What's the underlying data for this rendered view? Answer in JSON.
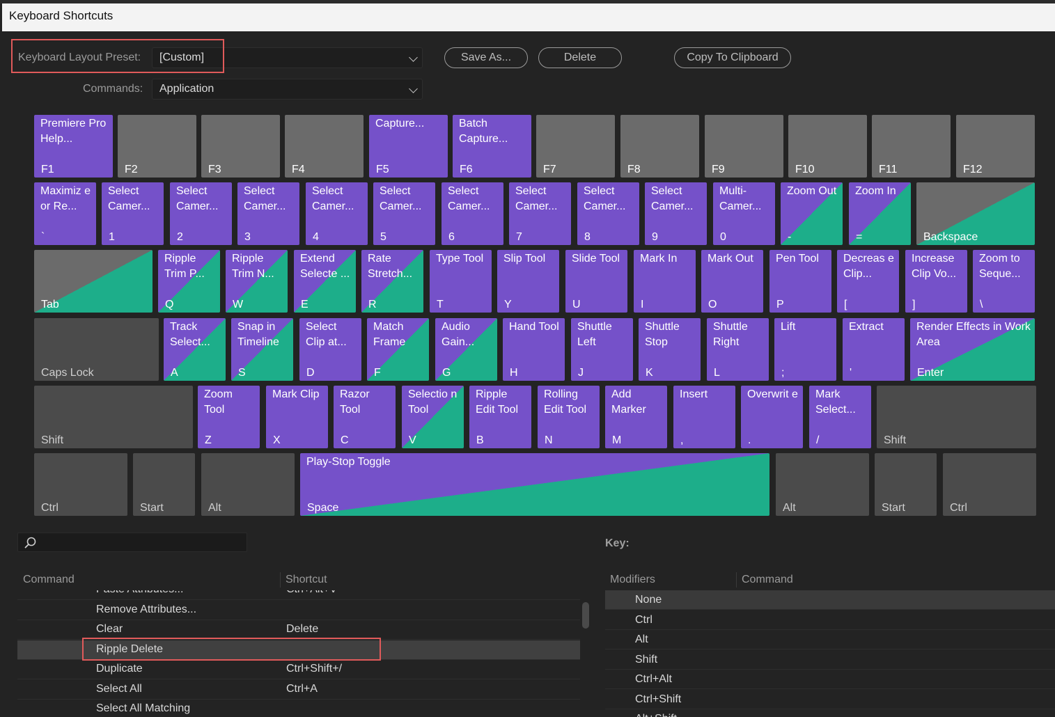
{
  "window": {
    "title": "Keyboard Shortcuts"
  },
  "preset": {
    "label": "Keyboard Layout Preset:",
    "value": "[Custom]"
  },
  "commands": {
    "label": "Commands:",
    "value": "Application"
  },
  "buttons": {
    "save_as": "Save As...",
    "delete": "Delete",
    "copy": "Copy To Clipboard"
  },
  "keyboard": {
    "rows": [
      [
        {
          "k": "F1",
          "c": "Premiere Pro Help...",
          "t": "app"
        },
        {
          "k": "F2",
          "c": "",
          "t": "none"
        },
        {
          "k": "F3",
          "c": "",
          "t": "none"
        },
        {
          "k": "F4",
          "c": "",
          "t": "none"
        },
        {
          "k": "F5",
          "c": "Capture...",
          "t": "app"
        },
        {
          "k": "F6",
          "c": "Batch Capture...",
          "t": "app"
        },
        {
          "k": "F7",
          "c": "",
          "t": "none"
        },
        {
          "k": "F8",
          "c": "",
          "t": "none"
        },
        {
          "k": "F9",
          "c": "",
          "t": "none"
        },
        {
          "k": "F10",
          "c": "",
          "t": "none"
        },
        {
          "k": "F11",
          "c": "",
          "t": "none"
        },
        {
          "k": "F12",
          "c": "",
          "t": "none"
        }
      ],
      [
        {
          "k": "`",
          "c": "Maximiz e or Re...",
          "t": "app"
        },
        {
          "k": "1",
          "c": "Select Camer...",
          "t": "app"
        },
        {
          "k": "2",
          "c": "Select Camer...",
          "t": "app"
        },
        {
          "k": "3",
          "c": "Select Camer...",
          "t": "app"
        },
        {
          "k": "4",
          "c": "Select Camer...",
          "t": "app"
        },
        {
          "k": "5",
          "c": "Select Camer...",
          "t": "app"
        },
        {
          "k": "6",
          "c": "Select Camer...",
          "t": "app"
        },
        {
          "k": "7",
          "c": "Select Camer...",
          "t": "app"
        },
        {
          "k": "8",
          "c": "Select Camer...",
          "t": "app"
        },
        {
          "k": "9",
          "c": "Select Camer...",
          "t": "app"
        },
        {
          "k": "0",
          "c": "Multi- Camer...",
          "t": "app"
        },
        {
          "k": "-",
          "c": "Zoom Out",
          "t": "mix"
        },
        {
          "k": "=",
          "c": "Zoom In",
          "t": "mix"
        },
        {
          "k": "Backspace",
          "c": "",
          "t": "panel"
        }
      ],
      [
        {
          "k": "Tab",
          "c": "",
          "t": "panel"
        },
        {
          "k": "Q",
          "c": "Ripple Trim P...",
          "t": "mix"
        },
        {
          "k": "W",
          "c": "Ripple Trim N...",
          "t": "mix"
        },
        {
          "k": "E",
          "c": "Extend Selecte ...",
          "t": "mix"
        },
        {
          "k": "R",
          "c": "Rate Stretch...",
          "t": "mix"
        },
        {
          "k": "T",
          "c": "Type Tool",
          "t": "app"
        },
        {
          "k": "Y",
          "c": "Slip Tool",
          "t": "app"
        },
        {
          "k": "U",
          "c": "Slide Tool",
          "t": "app"
        },
        {
          "k": "I",
          "c": "Mark In",
          "t": "app"
        },
        {
          "k": "O",
          "c": "Mark Out",
          "t": "app"
        },
        {
          "k": "P",
          "c": "Pen Tool",
          "t": "app"
        },
        {
          "k": "[",
          "c": "Decreas e Clip...",
          "t": "app"
        },
        {
          "k": "]",
          "c": "Increase Clip Vo...",
          "t": "app"
        },
        {
          "k": "\\",
          "c": "Zoom to Seque...",
          "t": "app"
        }
      ],
      [
        {
          "k": "Caps Lock",
          "c": "",
          "t": "mod"
        },
        {
          "k": "A",
          "c": "Track Select...",
          "t": "mix"
        },
        {
          "k": "S",
          "c": "Snap in Timeline",
          "t": "mix"
        },
        {
          "k": "D",
          "c": "Select Clip at...",
          "t": "app"
        },
        {
          "k": "F",
          "c": "Match Frame",
          "t": "mix"
        },
        {
          "k": "G",
          "c": "Audio Gain...",
          "t": "mix"
        },
        {
          "k": "H",
          "c": "Hand Tool",
          "t": "app"
        },
        {
          "k": "J",
          "c": "Shuttle Left",
          "t": "app"
        },
        {
          "k": "K",
          "c": "Shuttle Stop",
          "t": "app"
        },
        {
          "k": "L",
          "c": "Shuttle Right",
          "t": "app"
        },
        {
          "k": ";",
          "c": "Lift",
          "t": "app"
        },
        {
          "k": "'",
          "c": "Extract",
          "t": "app"
        },
        {
          "k": "Enter",
          "c": "Render Effects in Work Area",
          "t": "mix"
        }
      ],
      [
        {
          "k": "Shift",
          "c": "",
          "t": "mod"
        },
        {
          "k": "Z",
          "c": "Zoom Tool",
          "t": "app"
        },
        {
          "k": "X",
          "c": "Mark Clip",
          "t": "app"
        },
        {
          "k": "C",
          "c": "Razor Tool",
          "t": "app"
        },
        {
          "k": "V",
          "c": "Selectio n Tool",
          "t": "mix"
        },
        {
          "k": "B",
          "c": "Ripple Edit Tool",
          "t": "app"
        },
        {
          "k": "N",
          "c": "Rolling Edit Tool",
          "t": "app"
        },
        {
          "k": "M",
          "c": "Add Marker",
          "t": "app"
        },
        {
          "k": ",",
          "c": "Insert",
          "t": "app"
        },
        {
          "k": ".",
          "c": "Overwrit e",
          "t": "app"
        },
        {
          "k": "/",
          "c": "Mark Select...",
          "t": "app"
        },
        {
          "k": "Shift",
          "c": "",
          "t": "mod"
        }
      ],
      [
        {
          "k": "Ctrl",
          "c": "",
          "t": "mod"
        },
        {
          "k": "Start",
          "c": "",
          "t": "mod"
        },
        {
          "k": "Alt",
          "c": "",
          "t": "mod"
        },
        {
          "k": "Space",
          "c": "Play-Stop Toggle",
          "t": "mix"
        },
        {
          "k": "Alt",
          "c": "",
          "t": "mod"
        },
        {
          "k": "Start",
          "c": "",
          "t": "mod"
        },
        {
          "k": "Ctrl",
          "c": "",
          "t": "mod"
        }
      ]
    ]
  },
  "search": {
    "placeholder": ""
  },
  "list": {
    "headers": {
      "command": "Command",
      "shortcut": "Shortcut"
    },
    "rows": [
      {
        "command": "Paste Attributes...",
        "shortcut": "Ctrl+Alt+V"
      },
      {
        "command": "Remove Attributes...",
        "shortcut": ""
      },
      {
        "command": "Clear",
        "shortcut": "Delete"
      },
      {
        "command": "Ripple Delete",
        "shortcut": "",
        "selected": true
      },
      {
        "command": "Duplicate",
        "shortcut": "Ctrl+Shift+/"
      },
      {
        "command": "Select All",
        "shortcut": "Ctrl+A"
      },
      {
        "command": "Select All Matching",
        "shortcut": ""
      }
    ]
  },
  "key_panel": {
    "title": "Key:",
    "headers": {
      "modifiers": "Modifiers",
      "command": "Command"
    },
    "rows": [
      "None",
      "Ctrl",
      "Alt",
      "Shift",
      "Ctrl+Alt",
      "Ctrl+Shift",
      "Alt+Shift"
    ]
  },
  "colors": {
    "app_key": "#7551c9",
    "panel_key": "#1dae8a",
    "unassigned_key": "#6b6b6b",
    "highlight": "#e05a5a"
  }
}
